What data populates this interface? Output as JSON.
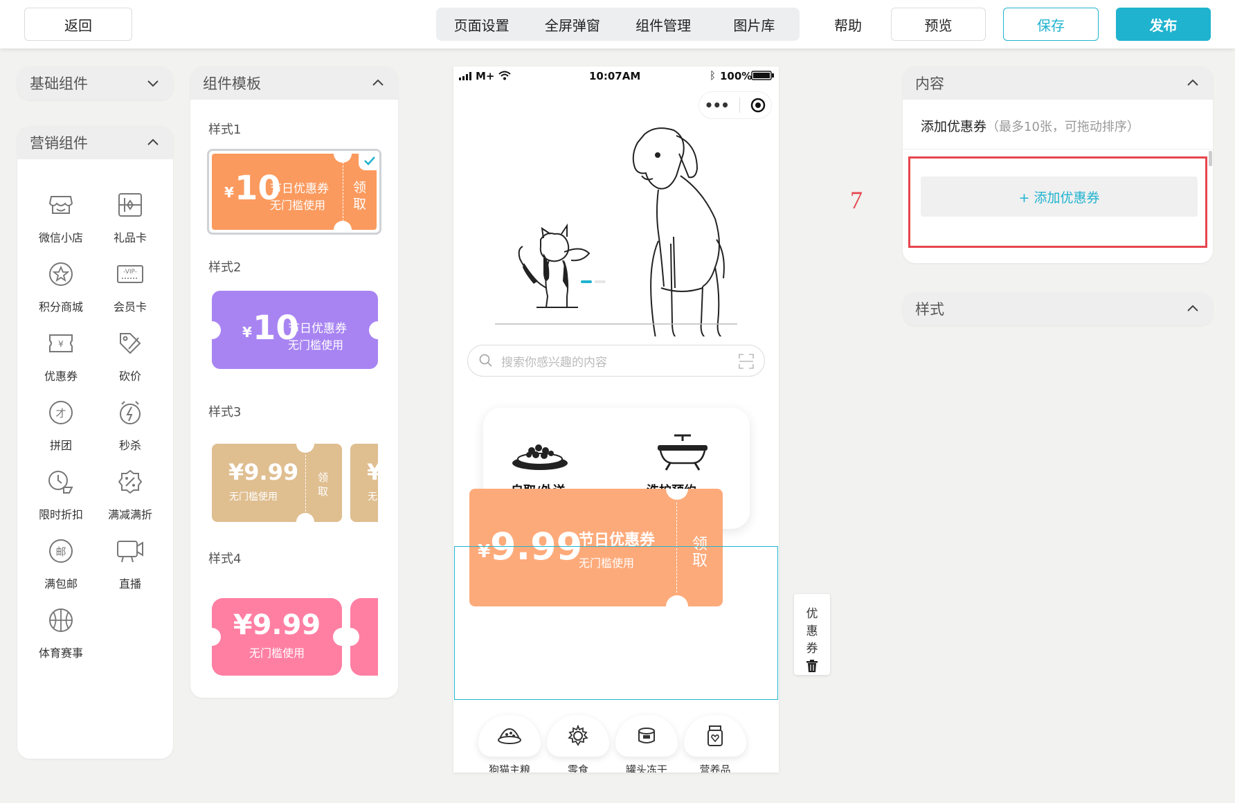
{
  "topbar": {
    "back": "返回",
    "menu": [
      "页面设置",
      "全屏弹窗",
      "组件管理",
      "图片库"
    ],
    "help": "帮助",
    "preview": "预览",
    "save": "保存",
    "publish": "发布"
  },
  "left": {
    "basic_title": "基础组件",
    "marketing_title": "营销组件",
    "items": [
      {
        "label": "微信小店",
        "icon": "shop-icon"
      },
      {
        "label": "礼品卡",
        "icon": "gift-card-icon"
      },
      {
        "label": "积分商城",
        "icon": "points-mall-icon"
      },
      {
        "label": "会员卡",
        "icon": "vip-card-icon"
      },
      {
        "label": "优惠券",
        "icon": "coupon-icon"
      },
      {
        "label": "砍价",
        "icon": "bargain-icon"
      },
      {
        "label": "拼团",
        "icon": "group-buy-icon"
      },
      {
        "label": "秒杀",
        "icon": "flash-sale-icon"
      },
      {
        "label": "限时折扣",
        "icon": "time-discount-icon"
      },
      {
        "label": "满减满折",
        "icon": "full-reduction-icon"
      },
      {
        "label": "满包邮",
        "icon": "free-shipping-icon"
      },
      {
        "label": "直播",
        "icon": "live-icon"
      },
      {
        "label": "体育赛事",
        "icon": "sports-icon"
      }
    ]
  },
  "templates": {
    "title": "组件模板",
    "styles": [
      "样式1",
      "样式2",
      "样式3",
      "样式4"
    ],
    "s1": {
      "yen": "¥",
      "amount": "10",
      "title": "节日优惠券",
      "sub": "无门槛使用",
      "claim1": "领",
      "claim2": "取"
    },
    "s2": {
      "yen": "¥",
      "amount": "10",
      "title": "节日优惠券",
      "sub": "无门槛使用"
    },
    "s3": {
      "amount": "¥9.99",
      "sub": "无门槛使用",
      "claim1": "领",
      "claim2": "取",
      "peek1": "¥",
      "peek2": "无"
    },
    "s4": {
      "amount": "¥9.99",
      "sub": "无门槛使用"
    }
  },
  "phone": {
    "carrier": "M+",
    "time": "10:07AM",
    "battery": "100%",
    "search_placeholder": "搜索你感兴趣的内容",
    "services": [
      "自取/外送",
      "洗护预约"
    ],
    "coupon": {
      "yen": "¥",
      "amount": "9.99",
      "title": "节日优惠券",
      "sub": "无门槛使用",
      "claim1": "领",
      "claim2": "取"
    },
    "categories": [
      "狗猫主粮",
      "零食",
      "罐头冻干",
      "营养品"
    ]
  },
  "side_tag": {
    "c1": "优",
    "c2": "惠",
    "c3": "券"
  },
  "right": {
    "content_title": "内容",
    "add_label": "添加优惠券",
    "add_hint": "（最多10张，可拖动排序）",
    "add_button": "+ 添加优惠券",
    "style_title": "样式",
    "step": "7"
  },
  "colors": {
    "accent": "#1fb3cf",
    "orange": "#fb9a5e",
    "purple": "#a884f2",
    "tan": "#dfbe90",
    "pink": "#ff7fa3",
    "big_coupon": "#fdaa7a",
    "highlight": "#e6454d"
  }
}
